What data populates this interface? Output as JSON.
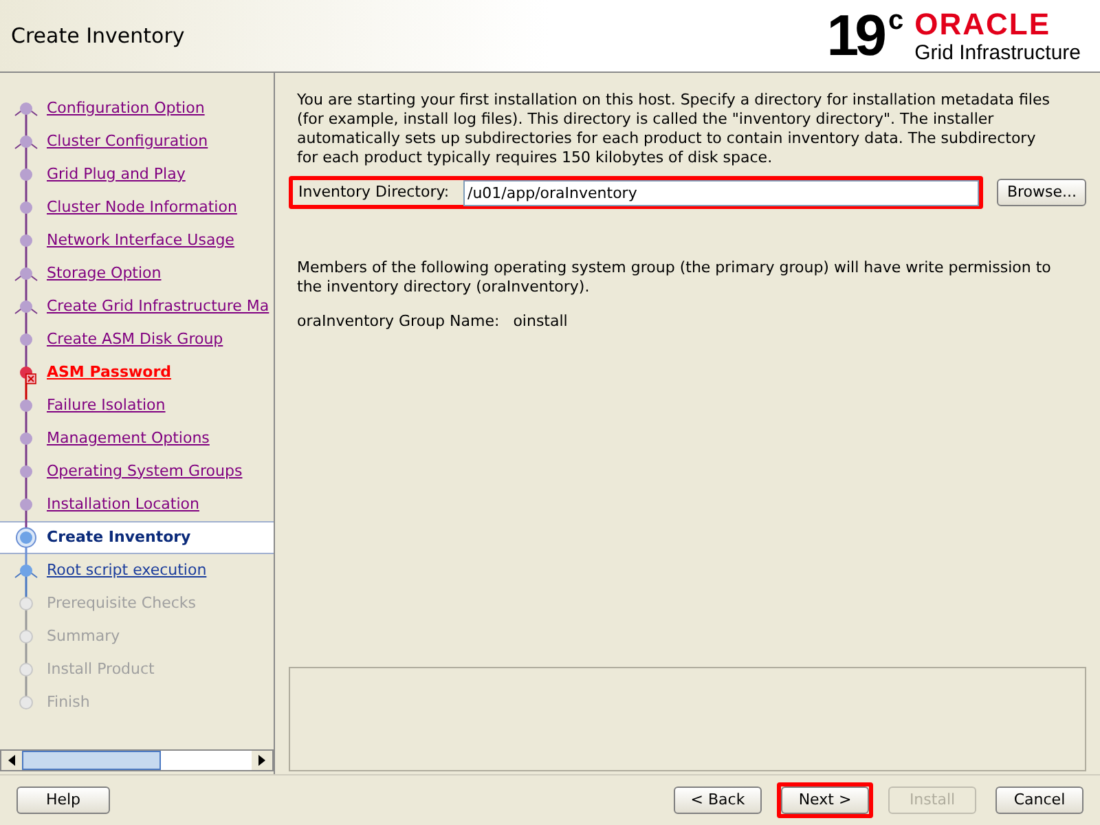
{
  "header": {
    "title": "Create Inventory",
    "logo_version": "19",
    "logo_superscript": "c",
    "logo_brand": "ORACLE",
    "logo_product": "Grid Infrastructure"
  },
  "steps": [
    {
      "label": "Configuration Option",
      "visited": true,
      "error": false,
      "selected": false,
      "disabled": false,
      "branch": true
    },
    {
      "label": "Cluster Configuration",
      "visited": true,
      "error": false,
      "selected": false,
      "disabled": false,
      "branch": true
    },
    {
      "label": "Grid Plug and Play",
      "visited": true,
      "error": false,
      "selected": false,
      "disabled": false,
      "branch": false
    },
    {
      "label": "Cluster Node Information",
      "visited": true,
      "error": false,
      "selected": false,
      "disabled": false,
      "branch": false
    },
    {
      "label": "Network Interface Usage",
      "visited": true,
      "error": false,
      "selected": false,
      "disabled": false,
      "branch": false
    },
    {
      "label": "Storage Option",
      "visited": true,
      "error": false,
      "selected": false,
      "disabled": false,
      "branch": true
    },
    {
      "label": "Create Grid Infrastructure Ma",
      "visited": true,
      "error": false,
      "selected": false,
      "disabled": false,
      "branch": true
    },
    {
      "label": "Create ASM Disk Group",
      "visited": true,
      "error": false,
      "selected": false,
      "disabled": false,
      "branch": false
    },
    {
      "label": "ASM Password",
      "visited": true,
      "error": true,
      "selected": false,
      "disabled": false,
      "branch": false
    },
    {
      "label": "Failure Isolation",
      "visited": true,
      "error": false,
      "selected": false,
      "disabled": false,
      "branch": false
    },
    {
      "label": "Management Options",
      "visited": true,
      "error": false,
      "selected": false,
      "disabled": false,
      "branch": false
    },
    {
      "label": "Operating System Groups",
      "visited": true,
      "error": false,
      "selected": false,
      "disabled": false,
      "branch": false
    },
    {
      "label": "Installation Location",
      "visited": true,
      "error": false,
      "selected": false,
      "disabled": false,
      "branch": false
    },
    {
      "label": "Create Inventory",
      "visited": false,
      "error": false,
      "selected": true,
      "disabled": false,
      "branch": false
    },
    {
      "label": "Root script execution",
      "visited": false,
      "error": false,
      "selected": false,
      "disabled": false,
      "branch": true
    },
    {
      "label": "Prerequisite Checks",
      "visited": false,
      "error": false,
      "selected": false,
      "disabled": true,
      "branch": false
    },
    {
      "label": "Summary",
      "visited": false,
      "error": false,
      "selected": false,
      "disabled": true,
      "branch": false
    },
    {
      "label": "Install Product",
      "visited": false,
      "error": false,
      "selected": false,
      "disabled": true,
      "branch": false
    },
    {
      "label": "Finish",
      "visited": false,
      "error": false,
      "selected": false,
      "disabled": true,
      "branch": false
    }
  ],
  "content": {
    "intro": "You are starting your first installation on this host. Specify a directory for installation metadata files (for example, install log files). This directory is called the \"inventory directory\". The installer automatically sets up subdirectories for each product to contain inventory data. The subdirectory for each product typically requires 150 kilobytes of disk space.",
    "directory_field": {
      "label": "Inventory Directory:",
      "value": "/u01/app/oraInventory",
      "highlighted": true
    },
    "browse_button": "Browse...",
    "group_note": "Members of the following operating system group (the primary group) will have write permission to the inventory directory (oraInventory).",
    "group_label": "oraInventory Group Name:",
    "group_value": "oinstall"
  },
  "buttons": [
    {
      "label": "Help",
      "disabled": false,
      "highlighted": false
    },
    {
      "label": "< Back",
      "disabled": false,
      "highlighted": false
    },
    {
      "label": "Next >",
      "disabled": false,
      "highlighted": true
    },
    {
      "label": "Install",
      "disabled": true,
      "highlighted": false
    },
    {
      "label": "Cancel",
      "disabled": false,
      "highlighted": false
    }
  ]
}
